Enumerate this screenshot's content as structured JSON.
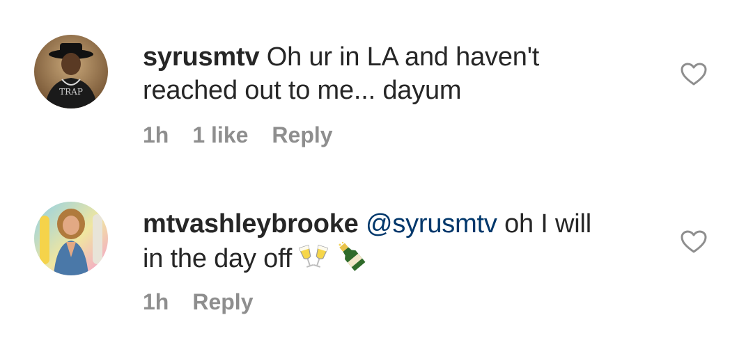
{
  "comments": [
    {
      "username": "syrusmtv",
      "mention": "",
      "text_line1": "Oh ur in LA and haven't",
      "text_line2": "reached out to me... dayum",
      "time": "1h",
      "likes": "1 like",
      "reply": "Reply",
      "avatar_icon": "profile-photo-man-with-hat",
      "heart_icon": "heart-outline-icon"
    },
    {
      "username": "mtvashleybrooke",
      "mention": "@syrusmtv",
      "text_line1": "oh I will",
      "text_line2": "in the day off",
      "emojis": "🥂🍾",
      "time": "1h",
      "reply": "Reply",
      "avatar_icon": "profile-photo-woman",
      "heart_icon": "heart-outline-icon"
    }
  ],
  "colors": {
    "text": "#262626",
    "meta": "#8e8e8e",
    "mention": "#00376b",
    "heart": "#8e8e8e"
  }
}
